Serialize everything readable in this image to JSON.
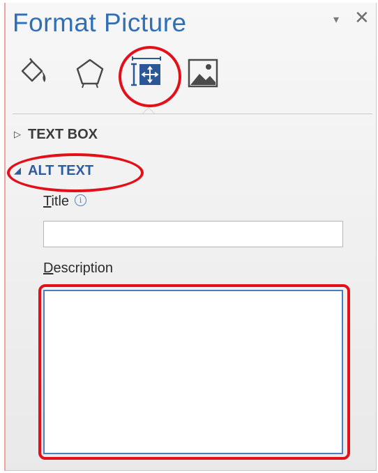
{
  "pane": {
    "title": "Format Picture",
    "dropdown_glyph": "▾",
    "close_glyph": "✕"
  },
  "tabs": [
    {
      "name": "fill-line-icon",
      "selected": false
    },
    {
      "name": "effects-icon",
      "selected": false
    },
    {
      "name": "size-properties-icon",
      "selected": true
    },
    {
      "name": "picture-icon",
      "selected": false
    }
  ],
  "sections": {
    "text_box": {
      "label": "TEXT BOX",
      "arrow": "▷",
      "expanded": false
    },
    "alt_text": {
      "label": "ALT TEXT",
      "arrow": "◢",
      "expanded": true
    }
  },
  "fields": {
    "title_label_u": "T",
    "title_label_rest": "itle",
    "title_info_glyph": "i",
    "title_value": "",
    "description_label_u": "D",
    "description_label_rest": "escription",
    "description_value": ""
  },
  "colors": {
    "title_blue": "#2f6fb5",
    "highlight_red": "#e3101a",
    "selected_tab_blue": "#2b5797"
  }
}
